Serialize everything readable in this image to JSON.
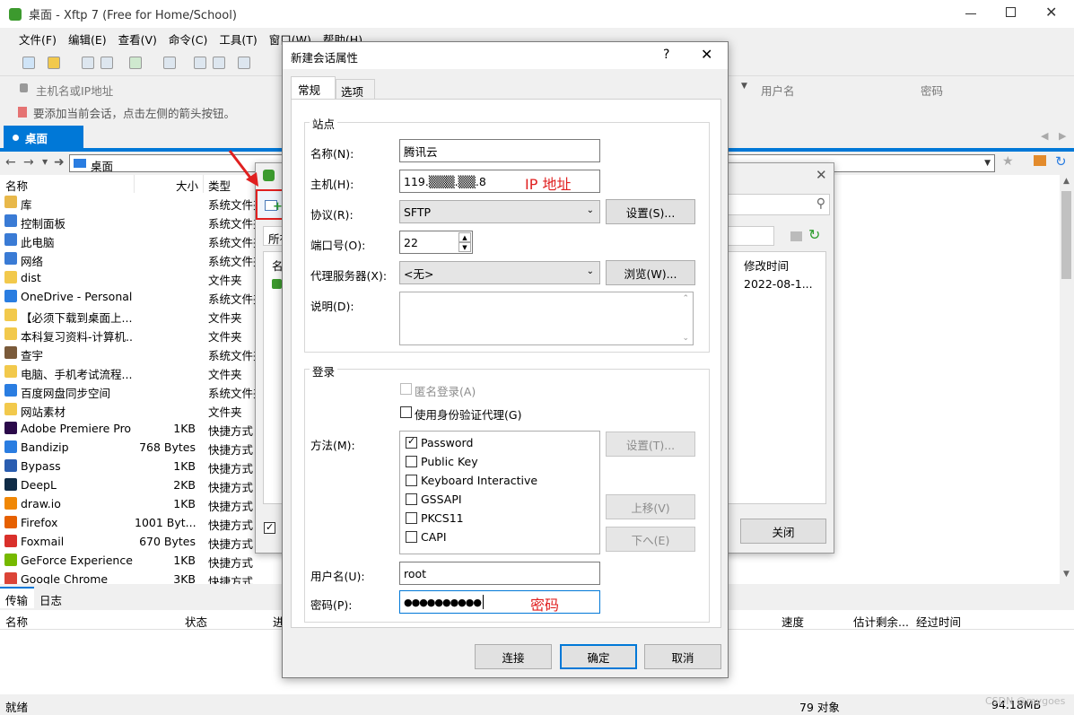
{
  "window": {
    "title": "桌面 - Xftp 7 (Free for Home/School)"
  },
  "menu": [
    "文件(F)",
    "编辑(E)",
    "查看(V)",
    "命令(C)",
    "工具(T)",
    "窗口(W)",
    "帮助(H)"
  ],
  "address": {
    "host_placeholder": "主机名或IP地址",
    "user_placeholder": "用户名",
    "pass_placeholder": "密码"
  },
  "hint": "要添加当前会话，点击左侧的箭头按钮。",
  "tab": {
    "label": "桌面"
  },
  "path": {
    "label": "桌面"
  },
  "columns": {
    "name": "名称",
    "size": "大小",
    "type": "类型"
  },
  "files": [
    {
      "name": "库",
      "size": "",
      "type": "系统文件夹",
      "color": "#e8b84a"
    },
    {
      "name": "控制面板",
      "size": "",
      "type": "系统文件夹",
      "color": "#3a7bd5"
    },
    {
      "name": "此电脑",
      "size": "",
      "type": "系统文件夹",
      "color": "#3a7bd5"
    },
    {
      "name": "网络",
      "size": "",
      "type": "系统文件夹",
      "color": "#3a7bd5"
    },
    {
      "name": "dist",
      "size": "",
      "type": "文件夹",
      "color": "#f2c94c"
    },
    {
      "name": "OneDrive - Personal",
      "size": "",
      "type": "系统文件夹",
      "color": "#2a7de1"
    },
    {
      "name": "【必须下载到桌面上...",
      "size": "",
      "type": "文件夹",
      "color": "#f2c94c"
    },
    {
      "name": "本科复习资料-计算机...",
      "size": "",
      "type": "文件夹",
      "color": "#f2c94c"
    },
    {
      "name": "查宇",
      "size": "",
      "type": "系统文件夹",
      "color": "#7a5a3a"
    },
    {
      "name": "电脑、手机考试流程...",
      "size": "",
      "type": "文件夹",
      "color": "#f2c94c"
    },
    {
      "name": "百度网盘同步空间",
      "size": "",
      "type": "系统文件夹",
      "color": "#2a7de1"
    },
    {
      "name": "网站素材",
      "size": "",
      "type": "文件夹",
      "color": "#f2c94c"
    },
    {
      "name": "Adobe Premiere Pro",
      "size": "1KB",
      "type": "快捷方式",
      "color": "#2b0a4a"
    },
    {
      "name": "Bandizip",
      "size": "768 Bytes",
      "type": "快捷方式",
      "color": "#2a7de1"
    },
    {
      "name": "Bypass",
      "size": "1KB",
      "type": "快捷方式",
      "color": "#2a5db0"
    },
    {
      "name": "DeepL",
      "size": "2KB",
      "type": "快捷方式",
      "color": "#0f2b46"
    },
    {
      "name": "draw.io",
      "size": "1KB",
      "type": "快捷方式",
      "color": "#f08705"
    },
    {
      "name": "Firefox",
      "size": "1001 Byt...",
      "type": "快捷方式",
      "color": "#e66000"
    },
    {
      "name": "Foxmail",
      "size": "670 Bytes",
      "type": "快捷方式",
      "color": "#d9302b"
    },
    {
      "name": "GeForce Experience",
      "size": "1KB",
      "type": "快捷方式",
      "color": "#76b900"
    },
    {
      "name": "Google Chrome",
      "size": "3KB",
      "type": "快捷方式",
      "color": "#db4437"
    }
  ],
  "bottom_tabs": [
    "传输",
    "日志"
  ],
  "transfer_columns": [
    "名称",
    "状态",
    "进",
    "速度",
    "估计剩余...",
    "经过时间"
  ],
  "status": {
    "left": "就绪",
    "objects": "79 对象",
    "size": "94.18MB",
    "watermark": "CSDN @mygoes"
  },
  "behind_dialog": {
    "col_modified": "修改时间",
    "modified_value": "2022-08-1...",
    "close_button": "关闭",
    "all_label": "所有",
    "name_short": "名称"
  },
  "dialog": {
    "title": "新建会话属性",
    "help": "?",
    "tabs": [
      "常规",
      "选项"
    ],
    "site_group": "站点",
    "name_label": "名称(N):",
    "name_value": "腾讯云",
    "host_label": "主机(H):",
    "host_value": "119.▒▒▒.▒▒.8",
    "ip_annotation": "IP 地址",
    "protocol_label": "协议(R):",
    "protocol_value": "SFTP",
    "settings_btn": "设置(S)...",
    "port_label": "端口号(O):",
    "port_value": "22",
    "proxy_label": "代理服务器(X):",
    "proxy_value": "<无>",
    "browse_btn": "浏览(W)...",
    "desc_label": "说明(D):",
    "login_group": "登录",
    "anon_label": "匿名登录(A)",
    "agent_label": "使用身份验证代理(G)",
    "method_label": "方法(M):",
    "methods": [
      {
        "label": "Password",
        "checked": true
      },
      {
        "label": "Public Key",
        "checked": false
      },
      {
        "label": "Keyboard Interactive",
        "checked": false
      },
      {
        "label": "GSSAPI",
        "checked": false
      },
      {
        "label": "PKCS11",
        "checked": false
      },
      {
        "label": "CAPI",
        "checked": false
      }
    ],
    "method_settings_btn": "设置(T)...",
    "up_btn": "上移(V)",
    "down_btn": "下へ(E)",
    "user_label": "用户名(U):",
    "user_value": "root",
    "pass_label": "密码(P):",
    "pass_value": "●●●●●●●●●●",
    "pass_annotation": "密码",
    "connect_btn": "连接",
    "ok_btn": "确定",
    "cancel_btn": "取消"
  },
  "colors": {
    "accent": "#0078d7",
    "annotation": "#e02020"
  }
}
